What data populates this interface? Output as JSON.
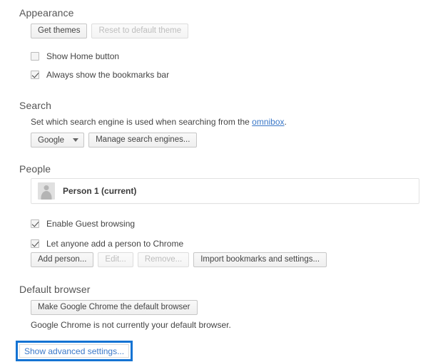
{
  "appearance": {
    "title": "Appearance",
    "buttons": [
      {
        "label": "Get themes",
        "disabled": false
      },
      {
        "label": "Reset to default theme",
        "disabled": true
      }
    ],
    "checkboxes": [
      {
        "label": "Show Home button",
        "checked": false
      },
      {
        "label": "Always show the bookmarks bar",
        "checked": true
      }
    ]
  },
  "search": {
    "title": "Search",
    "description_before": "Set which search engine is used when searching from the ",
    "link_label": "omnibox",
    "description_after": ".",
    "engine_selected": "Google",
    "manage_label": "Manage search engines..."
  },
  "people": {
    "title": "People",
    "profile_name": "Person 1 (current)",
    "avatar_icon": "person-avatar-icon",
    "checkboxes": [
      {
        "label": "Enable Guest browsing",
        "checked": true
      },
      {
        "label": "Let anyone add a person to Chrome",
        "checked": true
      }
    ],
    "buttons": [
      {
        "label": "Add person...",
        "disabled": false
      },
      {
        "label": "Edit...",
        "disabled": true
      },
      {
        "label": "Remove...",
        "disabled": true
      },
      {
        "label": "Import bookmarks and settings...",
        "disabled": false
      }
    ]
  },
  "default_browser": {
    "title": "Default browser",
    "button_label": "Make Google Chrome the default browser",
    "status_text": "Google Chrome is not currently your default browser."
  },
  "advanced": {
    "label": "Show advanced settings...",
    "highlight_color": "#1473d3"
  },
  "colors": {
    "link": "#3b78c8",
    "section_title": "#555555",
    "body_text": "#444444",
    "button_border": "#c6c6c6",
    "disabled_text": "#bdbdbd"
  }
}
